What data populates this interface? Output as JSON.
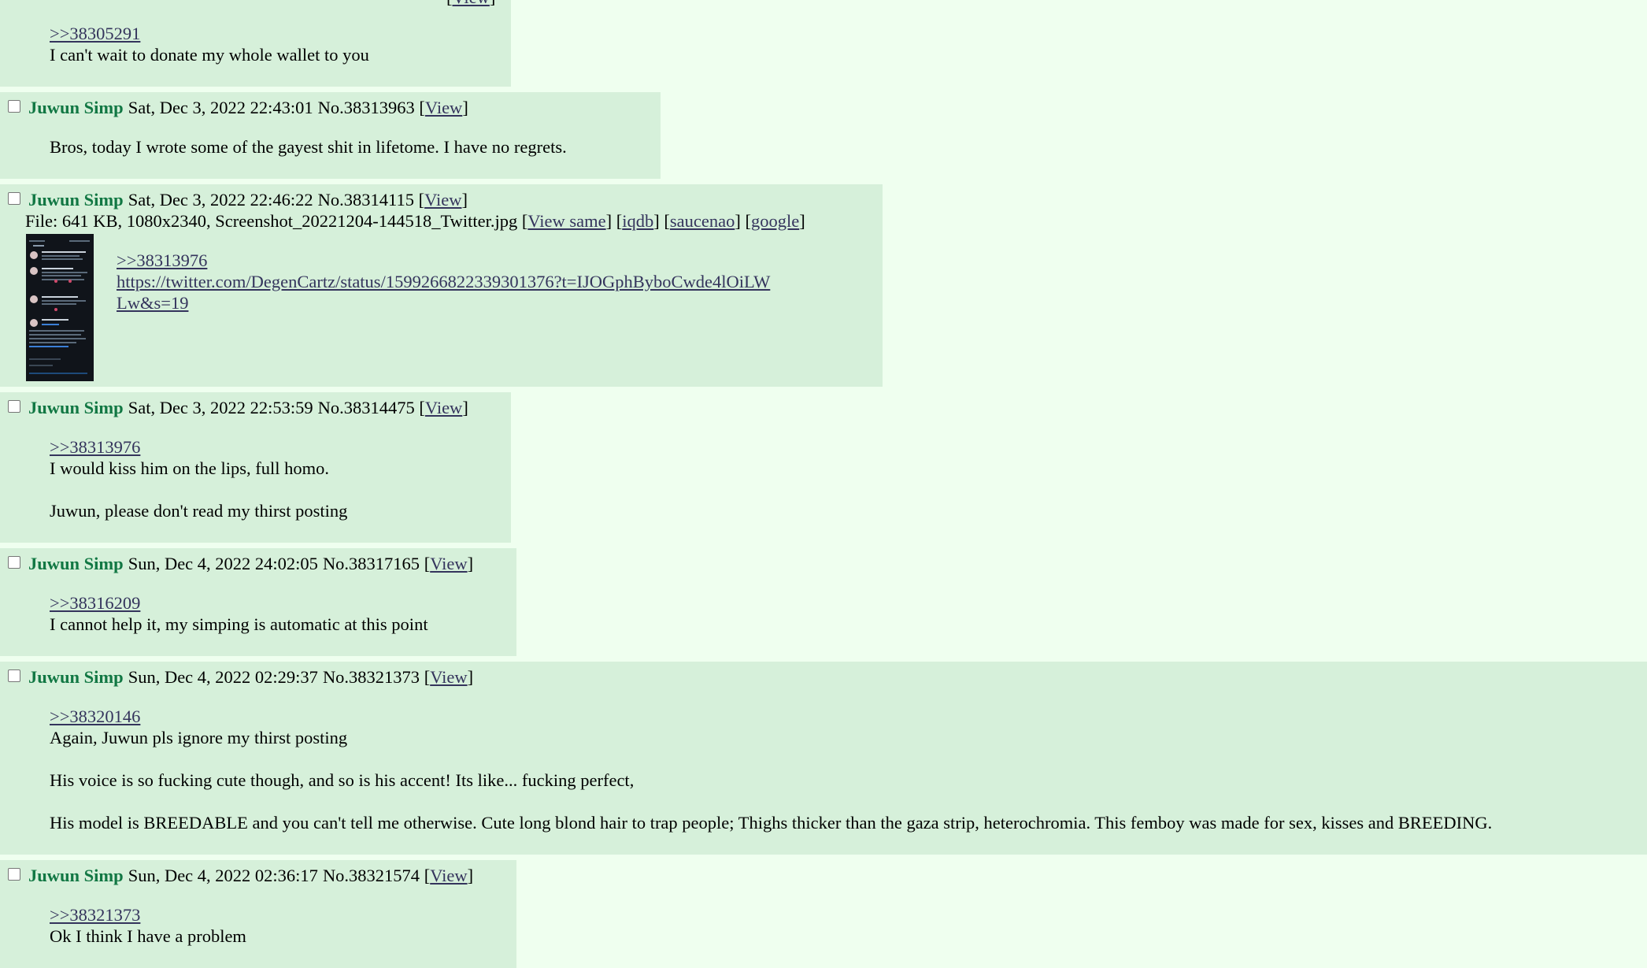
{
  "colors": {
    "page_bg": "#efffef",
    "post_bg": "#d6f0da",
    "name": "#117743",
    "link": "#34345c"
  },
  "posts": [
    {
      "top_partial": true,
      "view": "View",
      "quote": ">>38305291",
      "lines": [
        "I can't wait to donate my whole wallet to you"
      ]
    },
    {
      "name": "Juwun Simp",
      "datetime": "Sat, Dec 3, 2022 22:43:01",
      "no": "No.38313963",
      "view": "View",
      "lines": [
        "Bros, today I wrote some of the gayest shit in lifetome. I have no regrets."
      ]
    },
    {
      "name": "Juwun Simp",
      "datetime": "Sat, Dec 3, 2022 22:46:22",
      "no": "No.38314115",
      "view": "View",
      "file": {
        "prefix": "File: 641 KB, 1080x2340, Screenshot_20221204-144518_Twitter.jpg",
        "view_same": "View same",
        "iqdb": "iqdb",
        "saucenao": "saucenao",
        "google": "google"
      },
      "quote": ">>38313976",
      "url_line1": "https://twitter.com/DegenCartz/status/1599266822339301376?t=IJOGphByboCwde4lOiLW",
      "url_line2": "Lw&s=19"
    },
    {
      "name": "Juwun Simp",
      "datetime": "Sat, Dec 3, 2022 22:53:59",
      "no": "No.38314475",
      "view": "View",
      "quote": ">>38313976",
      "lines": [
        "I would kiss him on the lips, full homo.",
        "Juwun, please don't read my thirst posting"
      ]
    },
    {
      "name": "Juwun Simp",
      "datetime": "Sun, Dec 4, 2022 24:02:05",
      "no": "No.38317165",
      "view": "View",
      "quote": ">>38316209",
      "lines": [
        "I cannot help it, my simping is automatic at this point"
      ]
    },
    {
      "name": "Juwun Simp",
      "datetime": "Sun, Dec 4, 2022 02:29:37",
      "no": "No.38321373",
      "view": "View",
      "quote": ">>38320146",
      "lines": [
        "Again, Juwun pls ignore my thirst posting",
        "His voice is so fucking cute though, and so is his accent! Its like... fucking perfect,",
        "His model is BREEDABLE and you can't tell me otherwise. Cute long blond hair to trap people; Thighs thicker than the gaza strip, heterochromia. This femboy was made for sex, kisses and BREEDING."
      ]
    },
    {
      "name": "Juwun Simp",
      "datetime": "Sun, Dec 4, 2022 02:36:17",
      "no": "No.38321574",
      "view": "View",
      "quote": ">>38321373",
      "lines": [
        "Ok I think I have a problem"
      ]
    }
  ]
}
